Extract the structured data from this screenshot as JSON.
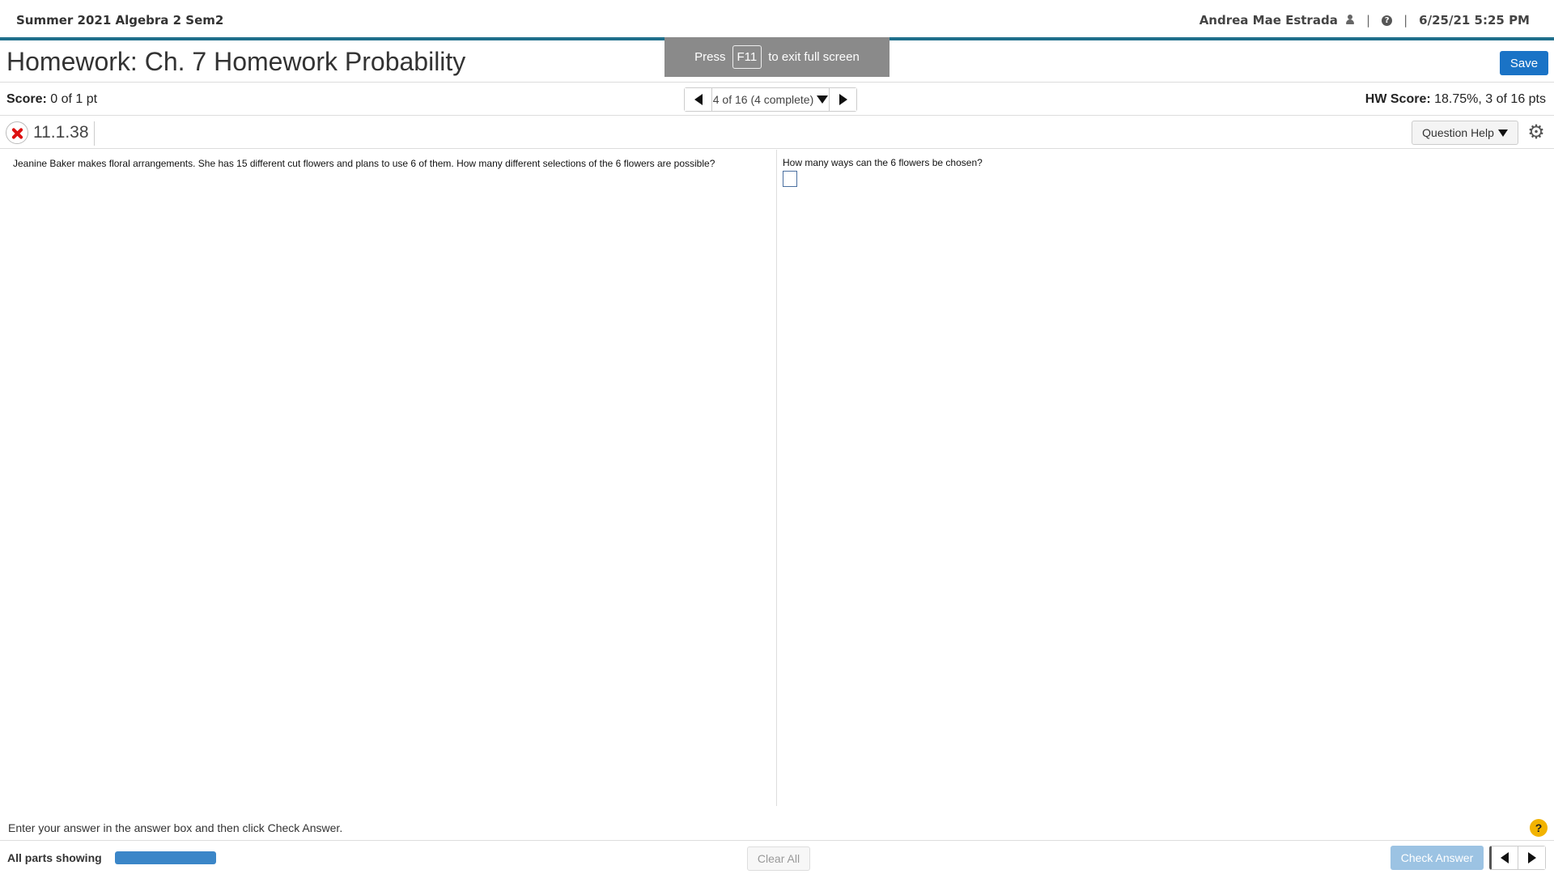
{
  "topbar": {
    "course": "Summer 2021 Algebra 2 Sem2",
    "user": "Andrea Mae Estrada",
    "separator": "|",
    "datetime": "6/25/21 5:25 PM"
  },
  "header": {
    "title": "Homework: Ch. 7 Homework Probability",
    "save_label": "Save"
  },
  "fullscreen_notice": {
    "press": "Press",
    "key": "F11",
    "rest": "to exit full screen"
  },
  "scorebar": {
    "score_label": "Score:",
    "score_value": "0 of 1 pt",
    "nav_label": "4 of 16 (4 complete)",
    "hw_score_label": "HW Score:",
    "hw_score_value": "18.75%, 3 of 16 pts"
  },
  "question": {
    "number": "11.1.38",
    "help_label": "Question Help",
    "text": "Jeanine Baker makes floral arrangements. She has 15 different cut flowers and plans to use 6 of them. How many different selections of the 6 flowers are possible?",
    "prompt": "How many ways can the 6 flowers be chosen?"
  },
  "footer": {
    "instruction": "Enter your answer in the answer box and then click Check Answer.",
    "parts_label": "All parts showing",
    "parts_progress": 1.0,
    "clear_label": "Clear All",
    "check_label": "Check Answer"
  },
  "colors": {
    "primary": "#1a73c6",
    "accent_bar": "#1f6f8b",
    "error": "#dd1111",
    "progress": "#3b86c8"
  }
}
